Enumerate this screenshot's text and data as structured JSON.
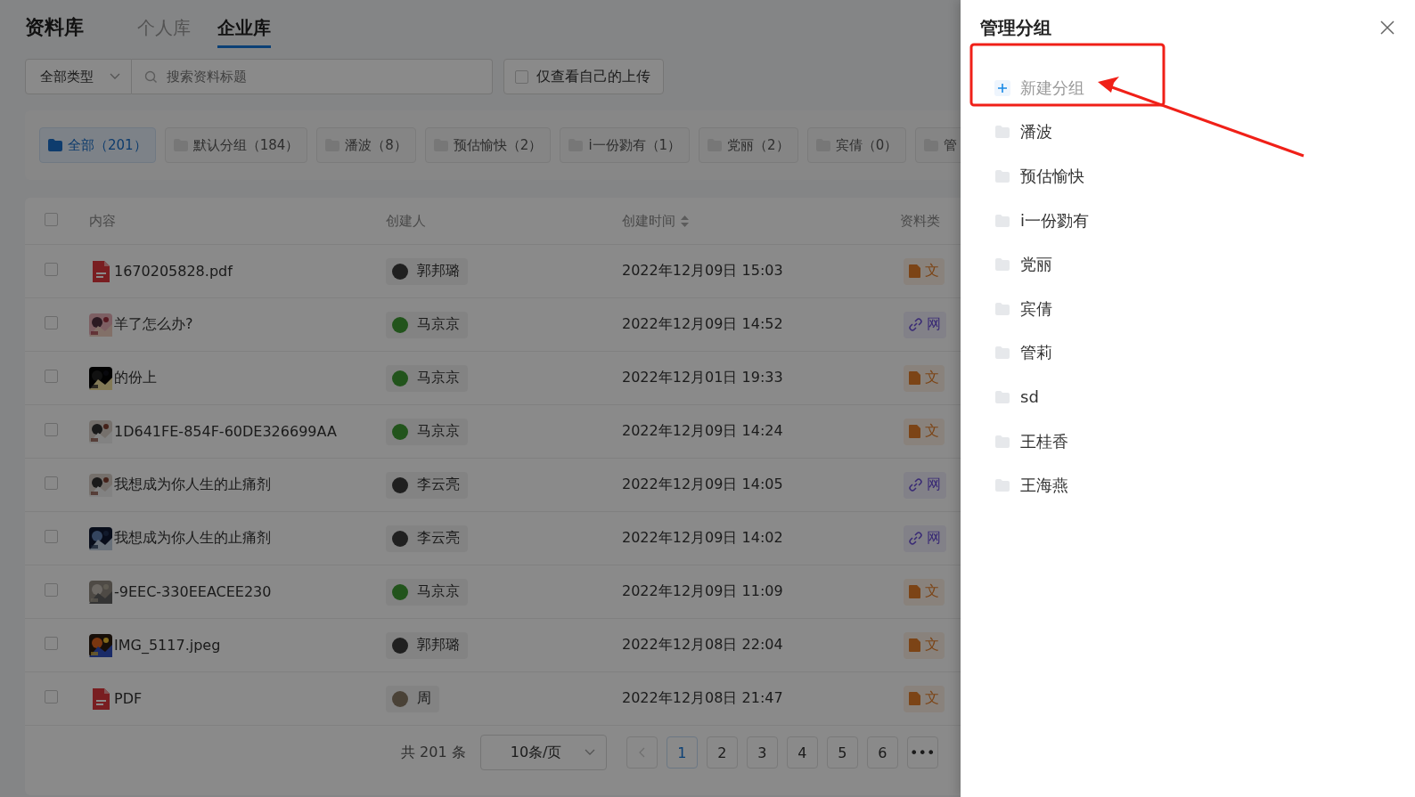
{
  "page": {
    "title": "资料库",
    "tabs": [
      {
        "label": "个人库",
        "selected": false
      },
      {
        "label": "企业库",
        "selected": true
      }
    ]
  },
  "filters": {
    "type_select": "全部类型",
    "search": {
      "placeholder": "搜索资料标题"
    },
    "only_mine": {
      "label": "仅查看自己的上传",
      "checked": false
    }
  },
  "groups": [
    {
      "label": "全部（201）",
      "selected": true
    },
    {
      "label": "默认分组（184）",
      "selected": false
    },
    {
      "label": "潘波（8）",
      "selected": false
    },
    {
      "label": "预估愉快（2）",
      "selected": false
    },
    {
      "label": "i一份勠有（1）",
      "selected": false
    },
    {
      "label": "党丽（2）",
      "selected": false
    },
    {
      "label": "宾倩（0）",
      "selected": false
    },
    {
      "label": "管",
      "selected": false
    }
  ],
  "table": {
    "select_all": {
      "checked": false
    },
    "columns": [
      {
        "label": "内容",
        "kind": "plain"
      },
      {
        "label": "创建人",
        "kind": "plain"
      },
      {
        "label": "创建时间",
        "kind": "sortable"
      },
      {
        "label": "资料类",
        "kind": "plain"
      }
    ],
    "rows": [
      {
        "selected": false,
        "thumb": {
          "kind": "pdf"
        },
        "title": "1670205828.pdf",
        "creator": {
          "name": "郭邦璐"
        },
        "time": "2022年12月09日 15:03",
        "type": {
          "kind": "file",
          "label": "文"
        }
      },
      {
        "selected": false,
        "title": "羊了怎么办?",
        "creator": {
          "name": "马京京",
          "kind": "frog"
        },
        "time": "2022年12月09日 14:52",
        "type": {
          "kind": "link",
          "label": "网"
        }
      },
      {
        "selected": false,
        "title": "的份上",
        "creator": {
          "name": "马京京",
          "kind": "frog"
        },
        "time": "2022年12月01日 19:33",
        "type": {
          "kind": "file",
          "label": "文"
        }
      },
      {
        "selected": false,
        "title": "1D641FE-854F-60DE326699AA",
        "creator": {
          "name": "马京京",
          "kind": "frog"
        },
        "time": "2022年12月09日 14:24",
        "type": {
          "kind": "file",
          "label": "文"
        }
      },
      {
        "selected": false,
        "title": "我想成为你人生的止痛剂",
        "creator": {
          "name": "李云亮"
        },
        "time": "2022年12月09日 14:05",
        "type": {
          "kind": "link",
          "label": "网"
        }
      },
      {
        "selected": false,
        "title": "我想成为你人生的止痛剂",
        "creator": {
          "name": "李云亮"
        },
        "time": "2022年12月09日 14:02",
        "type": {
          "kind": "link",
          "label": "网"
        }
      },
      {
        "selected": false,
        "title": "-9EEC-330EEACEE230",
        "creator": {
          "name": "马京京",
          "kind": "frog"
        },
        "time": "2022年12月09日 11:09",
        "type": {
          "kind": "file",
          "label": "文"
        }
      },
      {
        "selected": false,
        "title": "IMG_5117.jpeg",
        "creator": {
          "name": "郭邦璐"
        },
        "time": "2022年12月08日 22:04",
        "type": {
          "kind": "file",
          "label": "文"
        }
      },
      {
        "selected": false,
        "thumb": {
          "kind": "pdf"
        },
        "title": "PDF",
        "creator": {
          "name": "周",
          "kind": "portrait"
        },
        "time": "2022年12月08日 21:47",
        "type": {
          "kind": "file",
          "label": "文"
        }
      }
    ]
  },
  "pagination": {
    "total": "共 201 条",
    "page_size": "10条/页",
    "pages": [
      {
        "label": "1",
        "selected": true
      },
      {
        "label": "2",
        "selected": false
      },
      {
        "label": "3",
        "selected": false
      },
      {
        "label": "4",
        "selected": false
      },
      {
        "label": "5",
        "selected": false
      },
      {
        "label": "6",
        "selected": false
      }
    ],
    "more": "•••"
  },
  "drawer": {
    "title": "管理分组",
    "groups": [
      {
        "kind": "add",
        "label": "新建分组"
      },
      {
        "kind": "folder",
        "label": "潘波"
      },
      {
        "kind": "folder",
        "label": "预估愉快"
      },
      {
        "kind": "folder",
        "label": "i一份勠有"
      },
      {
        "kind": "folder",
        "label": "党丽"
      },
      {
        "kind": "folder",
        "label": "宾倩"
      },
      {
        "kind": "folder",
        "label": "管莉"
      },
      {
        "kind": "folder",
        "label": "sd"
      },
      {
        "kind": "folder",
        "label": "王桂香"
      },
      {
        "kind": "folder",
        "label": "王海燕"
      }
    ]
  }
}
